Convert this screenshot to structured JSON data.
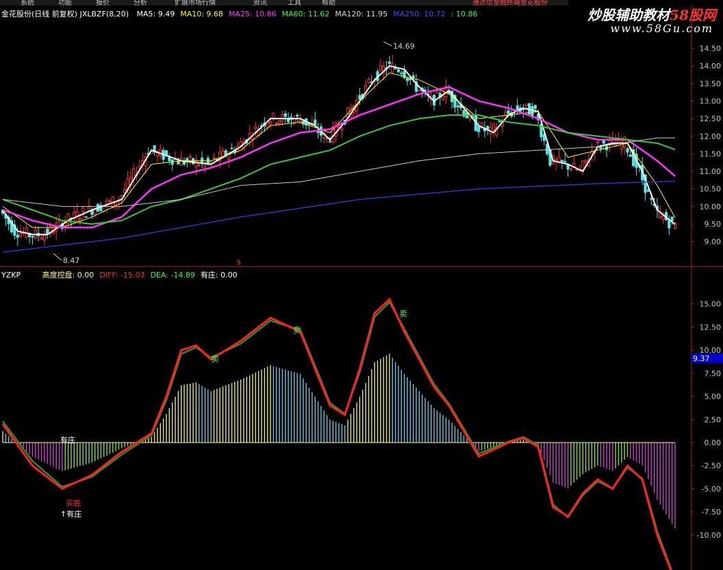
{
  "menu": {
    "items": [
      "系统",
      "功能",
      "报价",
      "分析",
      "扩展市场行情",
      "资讯",
      "工具",
      "帮助"
    ],
    "right_items": [
      "通达信金融终端",
      "金花股份"
    ]
  },
  "logo": {
    "line1a": "炒股辅助教材",
    "line1b": "58股网",
    "line2": "www.58Gu.com"
  },
  "header": {
    "title": "金花股份(日线 前复权)",
    "indicator": "JXLBZF(8,20)",
    "ma": [
      {
        "label": "MA5: 9.49",
        "color": "#ffffff"
      },
      {
        "label": "MA10: 9.68",
        "color": "#ffff00"
      },
      {
        "label": "MA25: 10.86",
        "color": "#ff33ff"
      },
      {
        "label": "MA60: 11.62",
        "color": "#33ff33"
      },
      {
        "label": "MA120: 11.95",
        "color": "#dddddd"
      },
      {
        "label": "MA250: 10.72",
        "color": "#4444ff"
      },
      {
        "label": ": 10.86",
        "color": "#33ff33"
      }
    ]
  },
  "sub_header": {
    "name": "YZKP",
    "items": [
      {
        "label": "高度控盘: 0.00",
        "color": "#ffff66"
      },
      {
        "label": "DIFF: -15.03",
        "color": "#ff3030"
      },
      {
        "label": "DEA: -14.89",
        "color": "#33ff33"
      },
      {
        "label": "有庄: 0.00",
        "color": "#ffffff"
      }
    ]
  },
  "annotations": {
    "high": "14.69",
    "low": "8.47",
    "sell": "卖",
    "bottom": "买底",
    "zhuang": "有庄",
    "zhuang_up": "↑有庄",
    "current_price": "9.37",
    "marker": "$"
  },
  "colors": {
    "up": "#ff3030",
    "down": "#55e8e8",
    "ma5": "#ffffff",
    "ma10": "#ffff00",
    "ma25": "#ff33ff",
    "ma60": "#33cc33",
    "ma120": "#cccccc",
    "ma250": "#3333cc",
    "axis": "#b02020",
    "diff": "#ff2020",
    "dea": "#2e8b2e"
  },
  "chart_data": [
    {
      "type": "candlestick",
      "title": "金花股份(日线 前复权)",
      "yticks": [
        9.0,
        9.5,
        10.0,
        10.5,
        11.0,
        11.5,
        12.0,
        12.5,
        13.0,
        13.5,
        14.0,
        14.5
      ],
      "ylim": [
        8.35,
        14.9
      ],
      "series": [
        {
          "name": "MA5",
          "x": [
            0,
            5,
            10,
            15,
            22,
            30,
            40,
            50,
            60,
            70,
            80,
            90,
            100,
            105,
            110,
            115,
            120,
            125,
            130,
            135,
            140,
            145,
            150,
            155,
            160,
            165,
            170,
            175,
            180,
            185,
            190,
            195,
            200,
            205,
            210,
            215,
            220,
            226
          ],
          "y": [
            9.9,
            9.3,
            9.2,
            9.2,
            9.6,
            9.9,
            10.2,
            11.6,
            11.3,
            11.2,
            11.7,
            12.5,
            12.5,
            12.3,
            11.9,
            12.4,
            13.0,
            13.6,
            14.0,
            13.9,
            13.4,
            13.0,
            13.3,
            12.8,
            12.3,
            12.1,
            12.6,
            12.8,
            12.7,
            11.3,
            11.2,
            11.0,
            11.7,
            11.8,
            11.8,
            11.0,
            9.9,
            9.49
          ]
        },
        {
          "name": "MA10",
          "x": [
            0,
            10,
            20,
            30,
            40,
            50,
            60,
            70,
            80,
            90,
            100,
            110,
            120,
            130,
            140,
            150,
            160,
            170,
            180,
            190,
            200,
            210,
            220,
            226
          ],
          "y": [
            10.0,
            9.4,
            9.4,
            9.7,
            10.1,
            11.2,
            11.3,
            11.3,
            11.6,
            12.3,
            12.4,
            12.1,
            13.0,
            13.8,
            13.6,
            13.2,
            12.5,
            12.6,
            12.7,
            11.4,
            11.6,
            11.8,
            10.6,
            9.68
          ]
        },
        {
          "name": "MA25",
          "x": [
            0,
            10,
            20,
            30,
            40,
            50,
            60,
            70,
            80,
            90,
            100,
            110,
            120,
            130,
            140,
            150,
            160,
            170,
            180,
            190,
            200,
            210,
            220,
            226
          ],
          "y": [
            9.9,
            9.6,
            9.4,
            9.4,
            9.7,
            10.5,
            10.9,
            11.1,
            11.4,
            11.8,
            12.1,
            12.2,
            12.6,
            12.9,
            13.2,
            13.4,
            13.0,
            12.8,
            12.5,
            12.1,
            11.9,
            11.9,
            11.3,
            10.86
          ]
        },
        {
          "name": "MA60",
          "x": [
            0,
            10,
            20,
            30,
            40,
            50,
            60,
            70,
            80,
            90,
            100,
            110,
            120,
            130,
            140,
            150,
            160,
            170,
            180,
            190,
            200,
            210,
            220,
            226
          ],
          "y": [
            10.2,
            9.9,
            9.6,
            9.5,
            9.6,
            10.0,
            10.2,
            10.5,
            10.8,
            11.2,
            11.4,
            11.6,
            12.0,
            12.3,
            12.5,
            12.6,
            12.6,
            12.4,
            12.3,
            12.1,
            12.0,
            11.9,
            11.8,
            11.62
          ]
        },
        {
          "name": "MA120",
          "x": [
            0,
            20,
            40,
            60,
            80,
            100,
            120,
            140,
            160,
            180,
            200,
            220,
            226
          ],
          "y": [
            10.2,
            10.0,
            10.0,
            10.2,
            10.6,
            10.7,
            11.0,
            11.3,
            11.5,
            11.6,
            11.7,
            11.95,
            11.95
          ]
        },
        {
          "name": "MA250",
          "x": [
            0,
            40,
            80,
            120,
            160,
            200,
            226
          ],
          "y": [
            8.7,
            9.1,
            9.7,
            10.2,
            10.5,
            10.65,
            10.72
          ]
        }
      ]
    },
    {
      "type": "line",
      "title": "YZKP",
      "yticks": [
        -10.0,
        -7.5,
        -5.0,
        -2.5,
        0.0,
        2.5,
        5.0,
        7.5,
        10.0,
        12.5,
        15.0
      ],
      "ylim": [
        -13.5,
        17.5
      ],
      "series": [
        {
          "name": "DIFF",
          "x": [
            0,
            10,
            20,
            30,
            40,
            50,
            55,
            60,
            65,
            70,
            80,
            90,
            100,
            105,
            110,
            115,
            120,
            125,
            130,
            135,
            140,
            145,
            150,
            160,
            170,
            175,
            180,
            185,
            190,
            195,
            200,
            205,
            210,
            215,
            220,
            226
          ],
          "y": [
            2.0,
            -2.5,
            -5.0,
            -3.5,
            -1.0,
            1.0,
            5.0,
            10.0,
            10.5,
            9.0,
            11.0,
            13.5,
            12.0,
            8.0,
            4.0,
            3.0,
            8.0,
            14.0,
            15.5,
            12.0,
            9.0,
            6.0,
            4.0,
            -1.5,
            0.0,
            0.5,
            -0.5,
            -7.0,
            -8.0,
            -5.5,
            -4.0,
            -5.0,
            -2.5,
            -4.0,
            -10.0,
            -15.03
          ]
        },
        {
          "name": "DEA",
          "x": [
            0,
            10,
            20,
            30,
            40,
            50,
            55,
            60,
            65,
            70,
            80,
            90,
            100,
            105,
            110,
            115,
            120,
            125,
            130,
            135,
            140,
            145,
            150,
            160,
            170,
            175,
            180,
            185,
            190,
            195,
            200,
            205,
            210,
            215,
            220,
            226
          ],
          "y": [
            2.3,
            -2.0,
            -4.8,
            -3.7,
            -1.3,
            0.8,
            4.6,
            9.6,
            10.3,
            9.2,
            10.7,
            13.2,
            12.2,
            8.3,
            4.3,
            3.1,
            7.6,
            13.6,
            15.2,
            12.3,
            9.3,
            6.3,
            4.2,
            -1.2,
            0.1,
            0.6,
            -0.3,
            -6.7,
            -8.1,
            -5.7,
            -4.2,
            -5.0,
            -2.7,
            -3.9,
            -9.6,
            -14.89
          ]
        },
        {
          "name": "高度控盘",
          "x": [
            0,
            226
          ],
          "y": [
            0.0,
            0.0
          ]
        },
        {
          "name": "有庄",
          "x": [
            0,
            226
          ],
          "y": [
            0.0,
            0.0
          ]
        }
      ]
    }
  ]
}
